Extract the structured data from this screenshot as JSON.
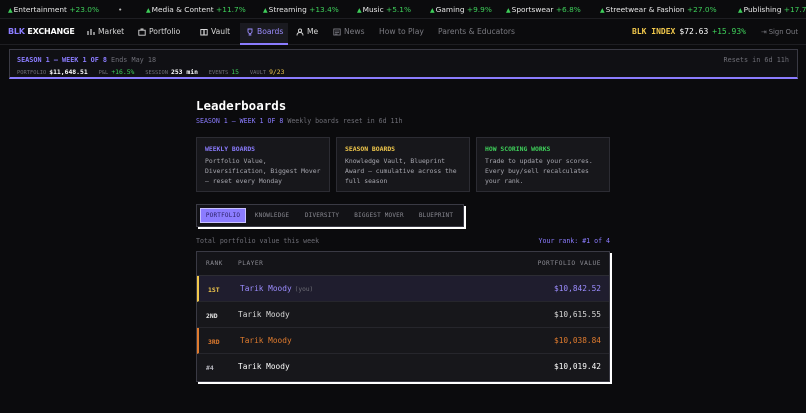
{
  "ticker": [
    {
      "name": "Entertainment",
      "change": "+23.0%"
    },
    {
      "name": "Media & Content",
      "change": "+11.7%"
    },
    {
      "name": "Streaming",
      "change": "+13.4%"
    },
    {
      "name": "Music",
      "change": "+5.1%"
    },
    {
      "name": "Gaming",
      "change": "+9.9%"
    },
    {
      "name": "Sportswear",
      "change": "+6.8%"
    },
    {
      "name": "Streetwear & Fashion",
      "change": "+27.0%"
    },
    {
      "name": "Publishing",
      "change": "+17.7"
    }
  ],
  "nav": {
    "logo_a": "BLK",
    "logo_b": "EXCHANGE",
    "items": [
      "Market",
      "Portfolio",
      "Vault",
      "Boards",
      "Me",
      "News",
      "How to Play",
      "Parents & Educators"
    ],
    "index_label": "BLK INDEX",
    "index_value": "$72.63",
    "index_change": "+15.93%",
    "signout": "Sign Out"
  },
  "banner": {
    "title": "SEASON 1 — WEEK 1 OF 8",
    "ends": "Ends May 18",
    "resets": "Resets in 6d 11h",
    "portfolio_label": "PORTFOLIO",
    "portfolio_value": "$11,648.51",
    "pnl_label": "P&L",
    "pnl_value": "+16.5%",
    "session_label": "SESSION",
    "session_value": "253 min",
    "events_label": "EVENTS",
    "events_value": "15",
    "vault_label": "VAULT",
    "vault_value": "9/23"
  },
  "main": {
    "title": "Leaderboards",
    "season": "SEASON 1 — WEEK 1 OF 8",
    "reset_note": "Weekly boards reset in 6d 11h",
    "cards": [
      {
        "title": "WEEKLY BOARDS",
        "body": "Portfolio Value, Diversification, Biggest Mover — reset every Monday",
        "color": "#8b7cff"
      },
      {
        "title": "SEASON BOARDS",
        "body": "Knowledge Vault, Blueprint Award — cumulative across the full season",
        "color": "#f2c94c"
      },
      {
        "title": "HOW SCORING WORKS",
        "body": "Trade to update your scores. Every buy/sell recalculates your rank.",
        "color": "#3ecf5a"
      }
    ],
    "tabs": [
      "PORTFOLIO",
      "KNOWLEDGE",
      "DIVERSITY",
      "BIGGEST MOVER",
      "BLUEPRINT"
    ],
    "total_label": "Total portfolio value this week",
    "your_rank": "Your rank: #1 of 4"
  },
  "table": {
    "headers": [
      "RANK",
      "PLAYER",
      "PORTFOLIO VALUE"
    ],
    "rows": [
      {
        "rank": "1ST",
        "player": "Tarik Moody",
        "tag": "(you)",
        "value": "$10,842.52",
        "color": "#f2c94c"
      },
      {
        "rank": "2ND",
        "player": "Tarik Moody",
        "tag": "",
        "value": "$10,615.55",
        "color": "#e6e6e6"
      },
      {
        "rank": "3RD",
        "player": "Tarik Moody",
        "tag": "",
        "value": "$10,038.84",
        "color": "#e07b2e"
      },
      {
        "rank": "#4",
        "player": "Tarik Moody",
        "tag": "",
        "value": "$10,019.42",
        "color": "#e6e6e6"
      }
    ]
  },
  "colors": {
    "accent": "#8b7cff",
    "gain": "#3ecf5a",
    "gold": "#f2c94c",
    "bronze": "#e07b2e"
  }
}
